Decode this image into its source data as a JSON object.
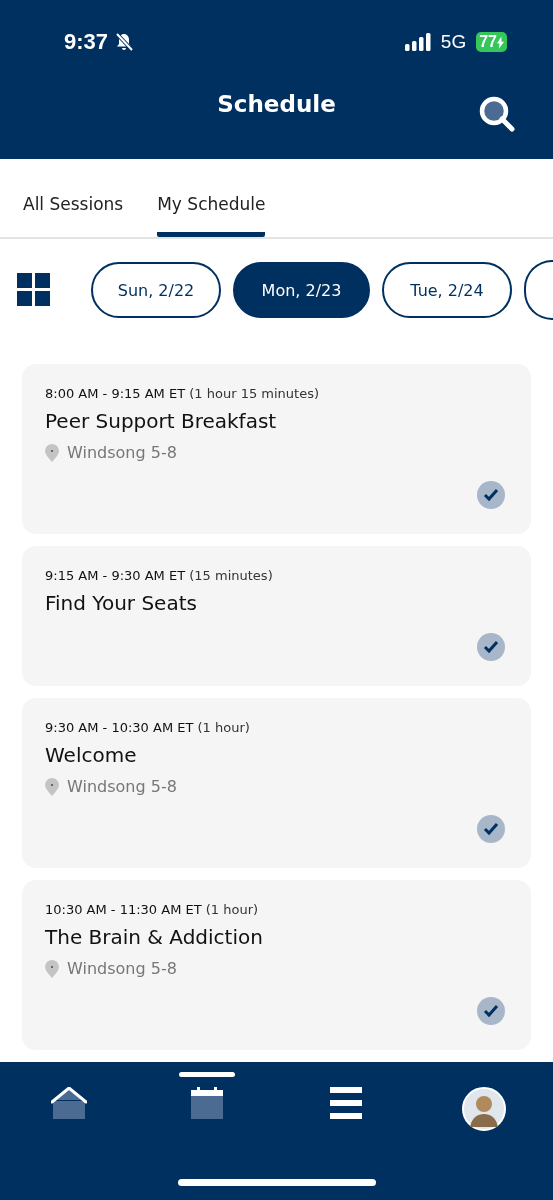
{
  "status_bar": {
    "time": "9:37",
    "network": "5G",
    "battery": "77"
  },
  "header": {
    "title": "Schedule"
  },
  "tabs": [
    {
      "label": "All Sessions",
      "selected": false
    },
    {
      "label": "My Schedule",
      "selected": true
    }
  ],
  "dates": [
    {
      "label": "Sun, 2/22",
      "selected": false
    },
    {
      "label": "Mon, 2/23",
      "selected": true
    },
    {
      "label": "Tue, 2/24",
      "selected": false
    }
  ],
  "sessions": [
    {
      "time": "8:00 AM - 9:15 AM ET",
      "duration": "(1 hour 15 minutes)",
      "title": "Peer Support Breakfast",
      "location": "Windsong 5-8",
      "added": true
    },
    {
      "time": "9:15 AM - 9:30 AM ET",
      "duration": "(15 minutes)",
      "title": "Find Your Seats",
      "added": true
    },
    {
      "time": "9:30 AM - 10:30 AM ET",
      "duration": "(1 hour)",
      "title": "Welcome",
      "location": "Windsong 5-8",
      "added": true
    },
    {
      "time": "10:30 AM - 11:30 AM ET",
      "duration": "(1 hour)",
      "title": "The Brain & Addiction",
      "location": "Windsong 5-8",
      "added": true
    }
  ],
  "bottom_nav": [
    {
      "kind": "home",
      "selected": false
    },
    {
      "kind": "calendar",
      "selected": true
    },
    {
      "kind": "menu",
      "selected": false
    },
    {
      "kind": "profile",
      "selected": false
    }
  ]
}
